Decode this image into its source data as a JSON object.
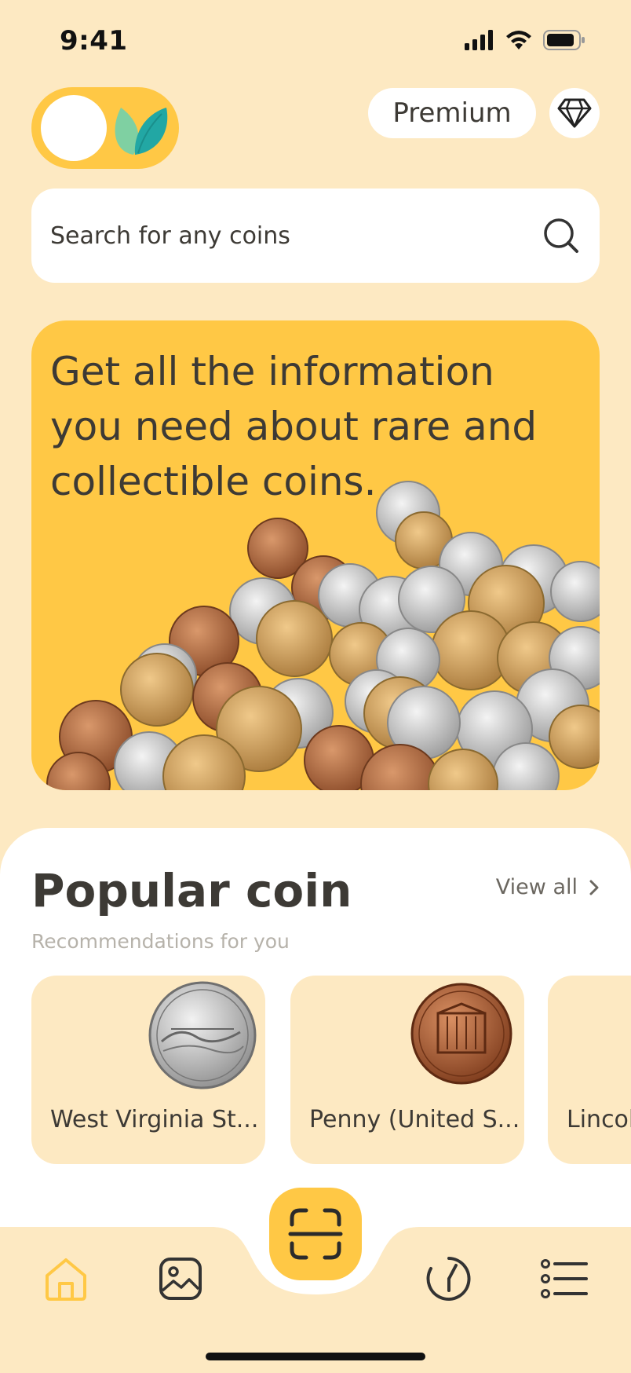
{
  "status_bar": {
    "time": "9:41",
    "icons": [
      "cellular-icon",
      "wifi-icon",
      "battery-icon"
    ]
  },
  "header": {
    "premium_label": "Premium",
    "toggle_icon": "leaf-icon",
    "diamond_icon": "diamond-icon"
  },
  "search": {
    "placeholder": "Search for any coins",
    "icon": "search-icon"
  },
  "banner": {
    "text": "Get all the information you need about rare and collectible coins."
  },
  "popular": {
    "title": "Popular coin",
    "view_all_label": "View all",
    "subtitle": "Recommendations for you",
    "items": [
      {
        "name": "West Virginia St..."
      },
      {
        "name": "Penny (United S..."
      },
      {
        "name": "Lincol"
      }
    ]
  },
  "tab_bar": {
    "icons": [
      "home-icon",
      "gallery-icon",
      "scan-icon",
      "history-icon",
      "list-icon"
    ]
  },
  "colors": {
    "background": "#FDE9C2",
    "accent": "#FFC845",
    "text": "#3d3a35",
    "muted": "#b6b2aa"
  }
}
